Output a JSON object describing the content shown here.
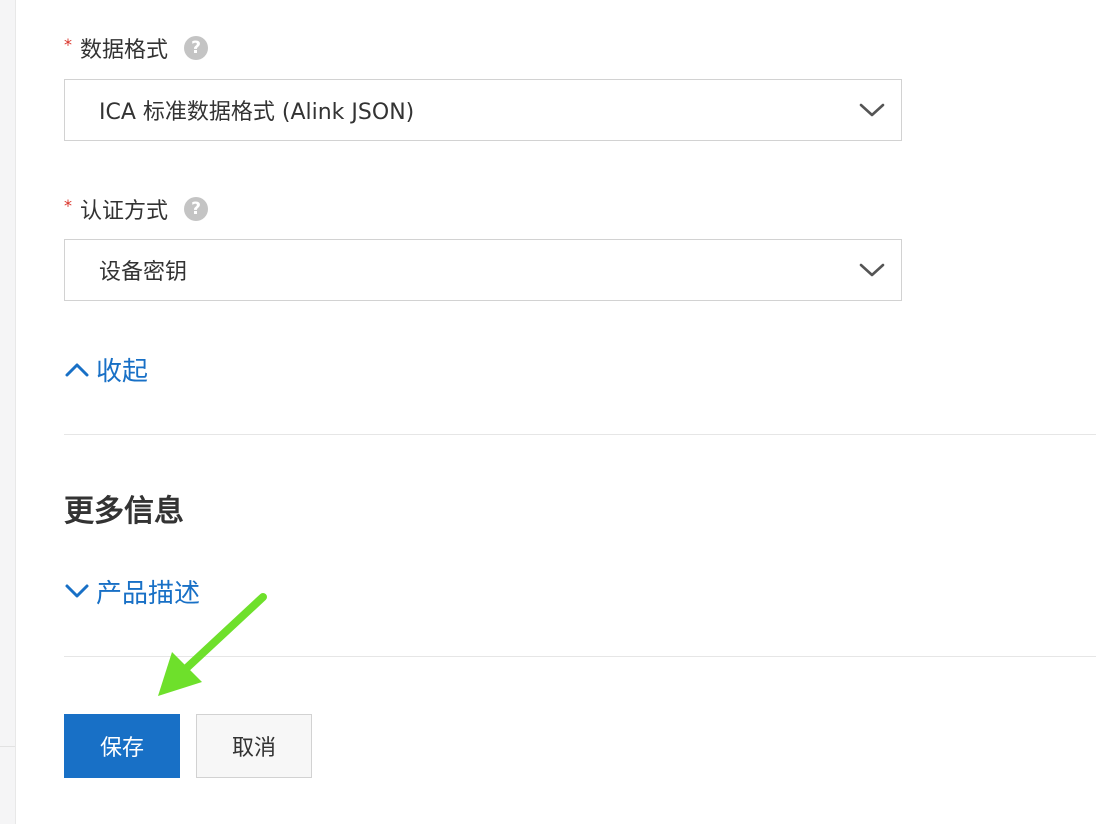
{
  "form": {
    "data_format": {
      "required_mark": "*",
      "label": "数据格式",
      "help_icon": "question-circle-icon",
      "value": "ICA 标准数据格式 (Alink JSON)"
    },
    "auth_method": {
      "required_mark": "*",
      "label": "认证方式",
      "help_icon": "question-circle-icon",
      "value": "设备密钥"
    },
    "collapse_link": {
      "label": "收起",
      "icon": "chevron-up-icon"
    }
  },
  "more_info": {
    "title": "更多信息",
    "product_description_link": {
      "label": "产品描述",
      "icon": "chevron-down-icon"
    }
  },
  "actions": {
    "save_label": "保存",
    "cancel_label": "取消"
  },
  "colors": {
    "accent": "#1870c6",
    "required": "#d93026",
    "annotation_arrow": "#6ee02b"
  }
}
